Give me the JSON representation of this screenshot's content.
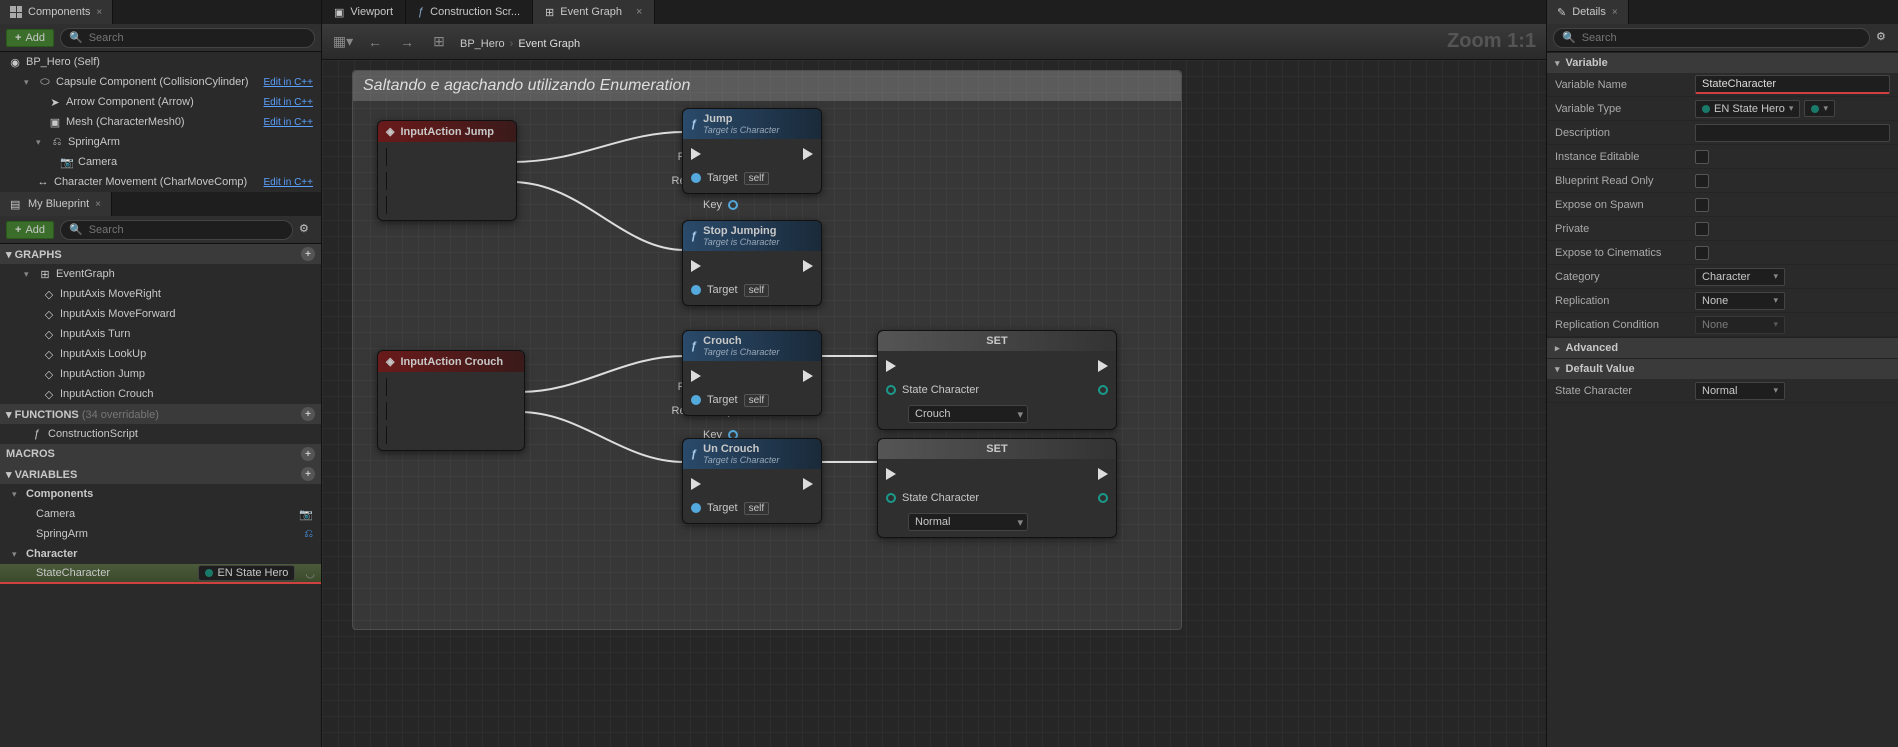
{
  "left": {
    "components_tab": "Components",
    "add": "Add",
    "search_placeholder": "Search",
    "tree": {
      "root": "BP_Hero (Self)",
      "capsule": "Capsule Component (CollisionCylinder)",
      "arrow": "Arrow Component (Arrow)",
      "mesh": "Mesh (CharacterMesh0)",
      "spring": "SpringArm",
      "camera": "Camera",
      "charmove": "Character Movement (CharMoveComp)",
      "edit_cpp": "Edit in C++"
    },
    "myblueprint_tab": "My Blueprint",
    "sections": {
      "graphs": "Graphs",
      "functions": "Functions",
      "functions_count": "(34 overridable)",
      "macros": "Macros",
      "variables": "Variables"
    },
    "graphs": {
      "eventgraph": "EventGraph",
      "items": [
        "InputAxis MoveRight",
        "InputAxis MoveForward",
        "InputAxis Turn",
        "InputAxis LookUp",
        "InputAction Jump",
        "InputAction Crouch"
      ]
    },
    "functions": {
      "construction": "ConstructionScript"
    },
    "variables": {
      "components_cat": "Components",
      "camera": "Camera",
      "springarm": "SpringArm",
      "character_cat": "Character",
      "statechar": "StateCharacter",
      "statechar_type": "EN State Hero"
    }
  },
  "center": {
    "tabs": {
      "viewport": "Viewport",
      "construction": "Construction Scr...",
      "eventgraph": "Event Graph"
    },
    "breadcrumb": {
      "bp": "BP_Hero",
      "graph": "Event Graph"
    },
    "zoom": "Zoom 1:1",
    "comment": "Saltando e agachando utilizando Enumeration",
    "nodes": {
      "inputjump": "InputAction Jump",
      "inputcrouch": "InputAction Crouch",
      "pressed": "Pressed",
      "released": "Released",
      "key": "Key",
      "jump": "Jump",
      "stopjump": "Stop Jumping",
      "crouch": "Crouch",
      "uncrouch": "Un Crouch",
      "target_char": "Target is Character",
      "target": "Target",
      "self": "self",
      "set": "SET",
      "statechar": "State Character",
      "val_crouch": "Crouch",
      "val_normal": "Normal"
    }
  },
  "right": {
    "tab": "Details",
    "search_placeholder": "Search",
    "cat_variable": "Variable",
    "cat_default": "Default Value",
    "props": {
      "varname_l": "Variable Name",
      "varname_v": "StateCharacter",
      "vartype_l": "Variable Type",
      "vartype_v": "EN State Hero",
      "desc_l": "Description",
      "inst_l": "Instance Editable",
      "bro_l": "Blueprint Read Only",
      "eos_l": "Expose on Spawn",
      "priv_l": "Private",
      "etc_l": "Expose to Cinematics",
      "cat_l": "Category",
      "cat_v": "Character",
      "rep_l": "Replication",
      "rep_v": "None",
      "repc_l": "Replication Condition",
      "repc_v": "None",
      "adv_l": "Advanced",
      "state_l": "State Character",
      "state_v": "Normal"
    }
  }
}
